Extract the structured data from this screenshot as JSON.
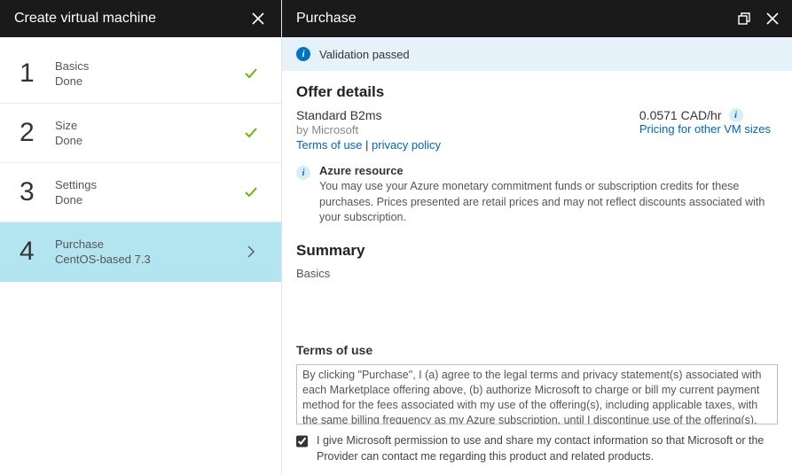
{
  "left": {
    "title": "Create virtual machine",
    "steps": [
      {
        "num": "1",
        "label": "Basics",
        "status": "Done",
        "kind": "done"
      },
      {
        "num": "2",
        "label": "Size",
        "status": "Done",
        "kind": "done"
      },
      {
        "num": "3",
        "label": "Settings",
        "status": "Done",
        "kind": "done"
      },
      {
        "num": "4",
        "label": "Purchase",
        "status": "CentOS-based 7.3",
        "kind": "active"
      }
    ]
  },
  "right": {
    "title": "Purchase",
    "validation": "Validation passed",
    "offer": {
      "heading": "Offer details",
      "name": "Standard B2ms",
      "by": "by Microsoft",
      "terms_link": "Terms of use",
      "privacy_link": "privacy policy",
      "separator": " | ",
      "price": "0.0571 CAD/hr",
      "pricing_link": "Pricing for other VM sizes"
    },
    "azure_resource": {
      "title": "Azure resource",
      "body": "You may use your Azure monetary commitment funds or subscription credits for these purchases. Prices presented are retail prices and may not reflect discounts associated with your subscription."
    },
    "summary_heading": "Summary",
    "cutoff_text": "Basics",
    "terms": {
      "heading": "Terms of use",
      "body": "By clicking \"Purchase\", I (a) agree to the legal terms and privacy statement(s) associated with each Marketplace offering above, (b) authorize Microsoft to charge or bill my current payment method for the fees associated with my use of the offering(s), including applicable taxes, with the same billing frequency as my Azure subscription, until I discontinue use of the offering(s), and (c)",
      "consent": "I give Microsoft permission to use and share my contact information so that Microsoft or the Provider can contact me regarding this product and related products."
    }
  }
}
